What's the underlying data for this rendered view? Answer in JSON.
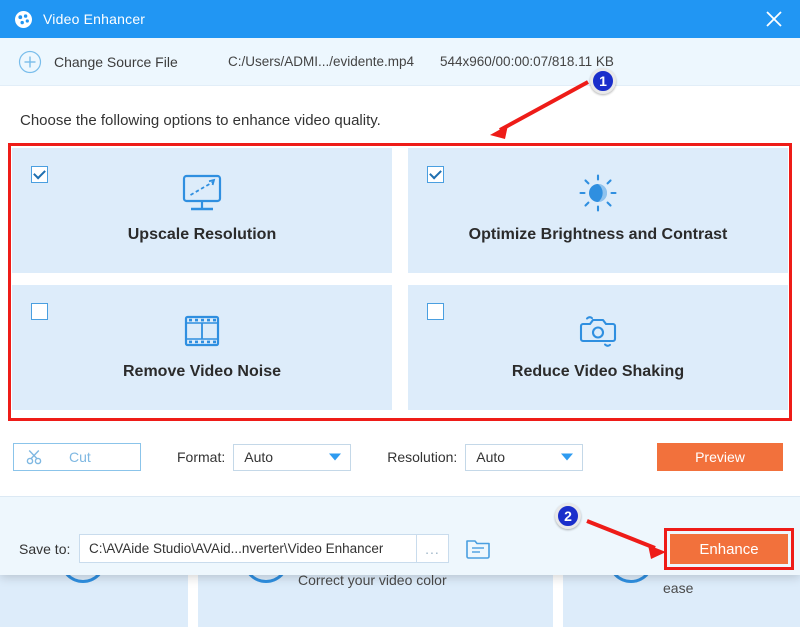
{
  "window": {
    "title": "Video Enhancer",
    "app_icon": "palette-icon",
    "close_icon": "close-icon",
    "titlebar_color": "#2196f3"
  },
  "source_bar": {
    "add_icon": "plus-circle-icon",
    "change_source_label": "Change Source File",
    "file_path": "C:/Users/ADMI.../evidente.mp4",
    "file_meta": "544x960/00:00:07/818.11 KB"
  },
  "instruction": "Choose the following options to enhance video quality.",
  "options": [
    {
      "label": "Upscale Resolution",
      "checked": true,
      "icon": "monitor-upscale-icon"
    },
    {
      "label": "Optimize Brightness and Contrast",
      "checked": true,
      "icon": "sun-brightness-icon"
    },
    {
      "label": "Remove Video Noise",
      "checked": false,
      "icon": "film-strip-icon"
    },
    {
      "label": "Reduce Video Shaking",
      "checked": false,
      "icon": "camera-shake-icon"
    }
  ],
  "toolbar": {
    "cut_label": "Cut",
    "cut_icon": "scissors-icon",
    "format_label": "Format:",
    "format_value": "Auto",
    "resolution_label": "Resolution:",
    "resolution_value": "Auto",
    "preview_label": "Preview",
    "dropdown_icon": "chevron-down-icon"
  },
  "save_row": {
    "save_to_label": "Save to:",
    "save_path": "C:\\AVAide Studio\\AVAid...nverter\\Video Enhancer",
    "browse_label": "...",
    "folder_icon": "folder-open-icon",
    "enhance_label": "Enhance"
  },
  "annotations": {
    "badge_1": "1",
    "badge_2": "2",
    "highlight_color": "#ee1c18",
    "arrow_color": "#ee1c18",
    "badge_color": "#1a2ecb",
    "accent_orange": "#f2713c"
  },
  "background": {
    "text_1": "Correct your video color",
    "text_2": "ease"
  }
}
